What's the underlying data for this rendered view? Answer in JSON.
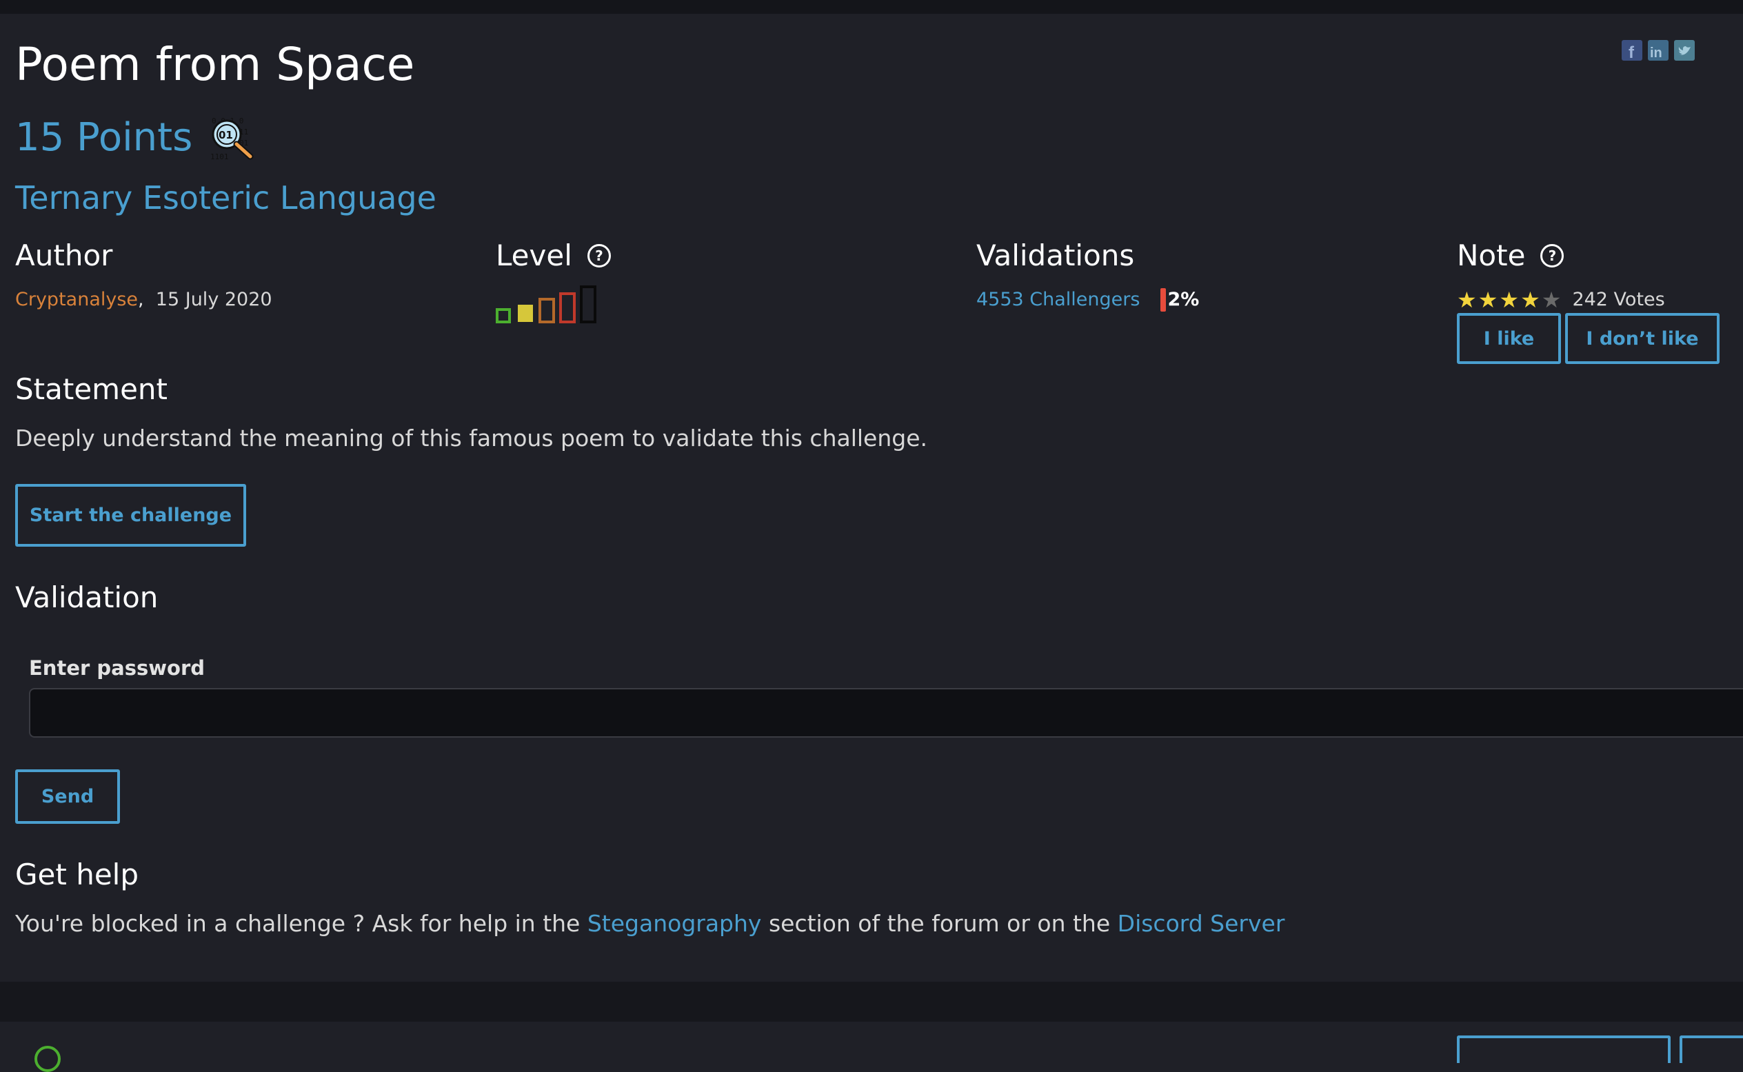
{
  "header": {
    "title": "Poem from Space",
    "points": "15 Points",
    "category_icon": "binary-magnifier-icon",
    "subtitle": "Ternary Esoteric Language",
    "social_icons": [
      "facebook-icon",
      "linkedin-icon",
      "twitter-icon"
    ]
  },
  "author": {
    "heading": "Author",
    "name": "Cryptanalyse",
    "separator": ",",
    "date": "15 July 2020"
  },
  "level": {
    "heading": "Level",
    "current_level": 2,
    "max_level": 5,
    "colors": [
      "#4caf2f",
      "#d6c73a",
      "#b4692a",
      "#c0392b",
      "#0a0a0a"
    ]
  },
  "validations": {
    "heading": "Validations",
    "challengers": "4553 Challengers",
    "percent": "2%",
    "bar_color": "#e74c3c"
  },
  "note": {
    "heading": "Note",
    "rating": 4,
    "max_rating": 5,
    "votes": "242 Votes",
    "like_label": "I like",
    "dislike_label": "I don’t like"
  },
  "statement": {
    "heading": "Statement",
    "text": "Deeply understand the meaning of this famous poem to validate this challenge.",
    "start_label": "Start the challenge"
  },
  "validation": {
    "heading": "Validation",
    "password_label": "Enter password",
    "password_value": "",
    "send_label": "Send"
  },
  "help": {
    "heading": "Get help",
    "text_before": "You're blocked in a challenge ? Ask for help in the ",
    "link1": "Steganography",
    "text_middle": " section of the forum or on the ",
    "link2": "Discord Server"
  },
  "colors": {
    "accent": "#4a9fcf",
    "author": "#d9823a",
    "background": "#1f2027"
  }
}
